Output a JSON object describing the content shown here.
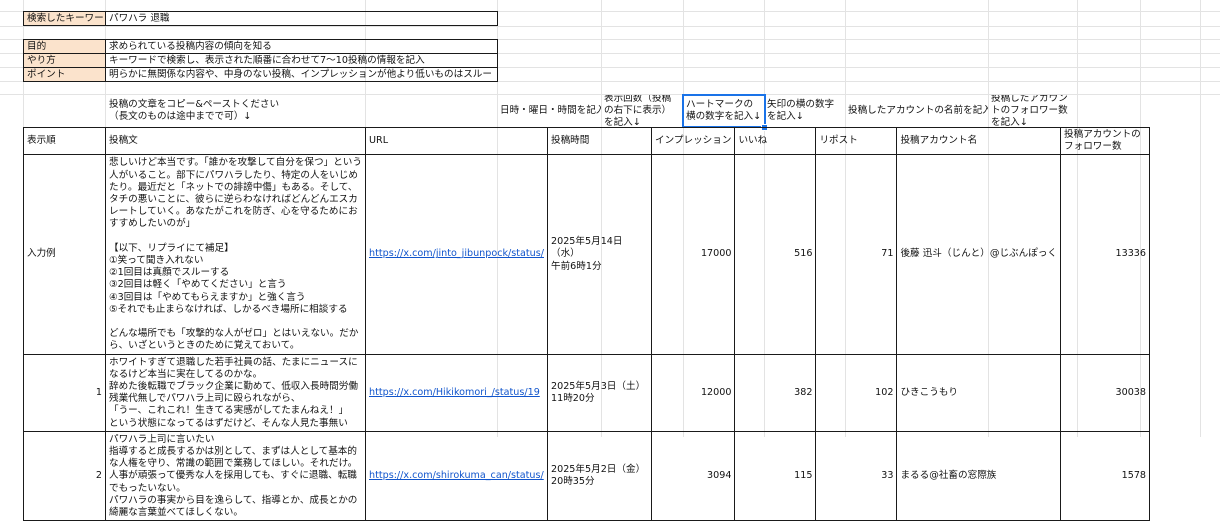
{
  "top": {
    "keyword_label": "検索したキーワード",
    "keyword_value": "パワハラ 退職",
    "rows": [
      {
        "label": "目的",
        "value": "求められている投稿内容の傾向を知る"
      },
      {
        "label": "やり方",
        "value": "キーワードで検索し、表示された順番に合わせて7〜10投稿の情報を記入"
      },
      {
        "label": "ポイント",
        "value": "明らかに無関係な内容や、中身のない投稿、インプレッションが他より低いものはスルー"
      }
    ]
  },
  "instructions": {
    "post": "投稿の文章をコピー&ペーストください\n（長文のものは途中までで可）↓",
    "datetime": "日時・曜日・時間を記入↓",
    "impressions": "表示回数（投稿の右下に表示）を記入↓",
    "likes": "ハートマークの横の数字を記入↓",
    "reposts": "矢印の横の数字を記入↓",
    "account": "投稿したアカウントの名前を記入↓",
    "followers": "投稿したアカウントのフォロワー数を記入↓"
  },
  "headers": {
    "order": "表示順",
    "post": "投稿文",
    "url": "URL",
    "time": "投稿時間",
    "impressions": "インプレッション",
    "likes": "いいね",
    "reposts": "リポスト",
    "account": "投稿アカウント名",
    "followers": "投稿アカウントの\nフォロワー数"
  },
  "rows": [
    {
      "order": "入力例",
      "post": "悲しいけど本当です。「誰かを攻撃して自分を保つ」という人がいること。部下にパワハラしたり、特定の人をいじめたり。最近だと「ネットでの誹謗中傷」もある。そして、タチの悪いことに、彼らに逆らわなければどんどんエスカレートしていく。あなたがこれを防ぎ、心を守るためにおすすめしたいのが」\n\n【以下、リプライにて補足】\n①笑って聞き入れない\n②1回目は真顔でスルーする\n③2回目は軽く「やめてください」と言う\n④3回目は「やめてもらえますか」と強く言う\n⑤それでも止まらなければ、しかるべき場所に相談する\n\nどんな場所でも「攻撃的な人がゼロ」とはいえない。だから、いざというときのために覚えておいて。",
      "url": "https://x.com/jinto_jibunpock/status/",
      "time": "2025年5月14日（水）\n午前6時1分",
      "impressions": "17000",
      "likes": "516",
      "reposts": "71",
      "account": "後藤 迅斗（じんと）@じぶんぽっく",
      "followers": "13336"
    },
    {
      "order": "1",
      "post": "ホワイトすぎて退職した若手社員の話、たまにニュースになるけど本当に実在してるのかな。\n辞めた後転職でブラック企業に勤めて、低収入長時間労働残業代無しでパワハラ上司に殴られながら、\n「うー、これこれ！生きてる実感がしてたまんねえ！」\nという状態になってるはずだけど、そんな人見た事無い",
      "url": "https://x.com/Hikikomori_/status/19",
      "time": "2025年5月3日（土）\n11時20分",
      "impressions": "12000",
      "likes": "382",
      "reposts": "102",
      "account": "ひきこうもり",
      "followers": "30038"
    },
    {
      "order": "2",
      "post": "パワハラ上司に言いたい\n指導すると成長するかは別として、まずは人として基本的な人権を守り、常識の範囲で業務してほしい。それだけ。人事が頑張って優秀な人を採用しても、すぐに退職、転職でもったいない。\nパワハラの事実から目を逸らして、指導とか、成長とかの綺麗な言葉並べてほしくない。",
      "url": "https://x.com/shirokuma_can/status/",
      "time": "2025年5月2日（金）\n20時35分",
      "impressions": "3094",
      "likes": "115",
      "reposts": "33",
      "account": "まるる@社畜の窓際族",
      "followers": "1578"
    }
  ],
  "colors": {
    "label_bg": "#fbe3cc",
    "link": "#1155cc",
    "selection": "#1a73e8",
    "gridline": "#e3e3e3"
  }
}
